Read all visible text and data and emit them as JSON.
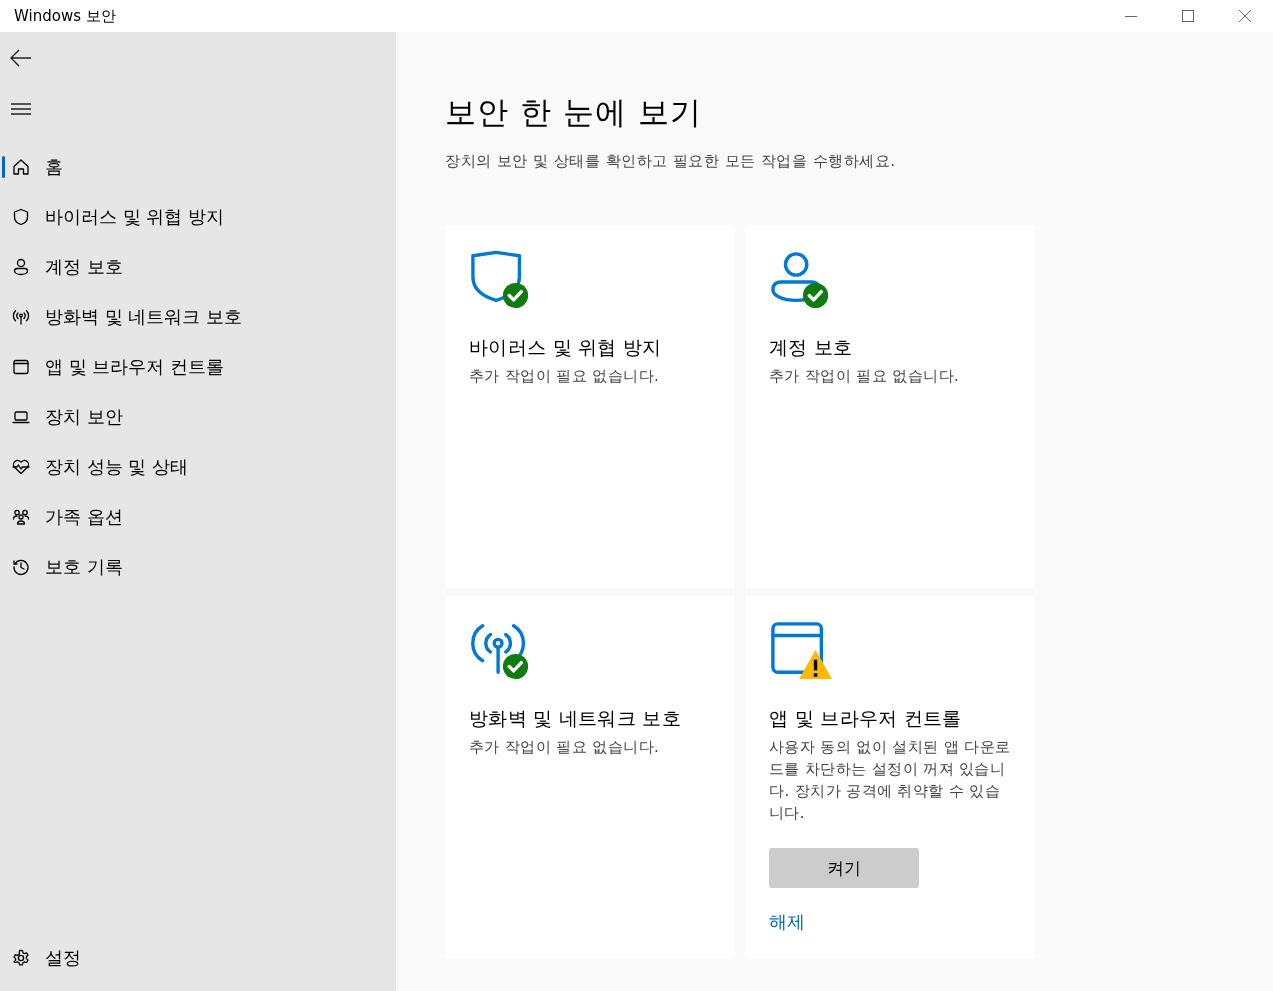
{
  "window": {
    "title": "Windows 보안"
  },
  "sidebar": {
    "items": [
      {
        "label": "홈",
        "selected": true
      },
      {
        "label": "바이러스 및 위협 방지",
        "selected": false
      },
      {
        "label": "계정 보호",
        "selected": false
      },
      {
        "label": "방화벽 및 네트워크 보호",
        "selected": false
      },
      {
        "label": "앱 및 브라우저 컨트롤",
        "selected": false
      },
      {
        "label": "장치 보안",
        "selected": false
      },
      {
        "label": "장치 성능 및 상태",
        "selected": false
      },
      {
        "label": "가족 옵션",
        "selected": false
      },
      {
        "label": "보호 기록",
        "selected": false
      }
    ],
    "footer": {
      "label": "설정",
      "selected": false
    }
  },
  "main": {
    "heading": "보안 한 눈에 보기",
    "subtitle": "장치의 보안 및 상태를 확인하고 필요한 모든 작업을 수행하세요.",
    "cards": [
      {
        "title": "바이러스 및 위협 방지",
        "description": "추가 작업이 필요 없습니다.",
        "kind": "ok"
      },
      {
        "title": "계정 보호",
        "description": "추가 작업이 필요 없습니다.",
        "kind": "ok"
      },
      {
        "title": "방화벽 및 네트워크 보호",
        "description": "추가 작업이 필요 없습니다.",
        "kind": "ok"
      },
      {
        "title": "앱 및 브라우저 컨트롤",
        "description": "사용자 동의 없이 설치된 앱 다운로드를 차단하는 설정이 꺼져 있습니다. 장치가 공격에 취약할 수 있습니다.",
        "kind": "warning",
        "button": "켜기",
        "link": "해제"
      }
    ]
  }
}
